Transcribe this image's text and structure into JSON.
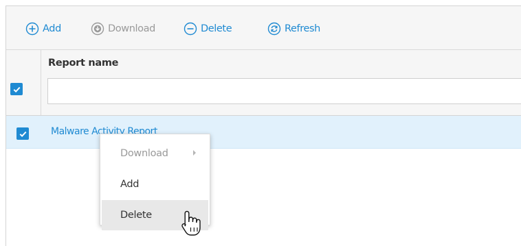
{
  "toolbar": {
    "add_label": "Add",
    "download_label": "Download",
    "delete_label": "Delete",
    "refresh_label": "Refresh"
  },
  "grid": {
    "column_header": "Report name",
    "filter_value": "",
    "rows": [
      {
        "name": "Malware Activity Report",
        "checked": true
      }
    ]
  },
  "context_menu": {
    "items": [
      {
        "label": "Download",
        "enabled": false,
        "has_submenu": true
      },
      {
        "label": "Add",
        "enabled": true
      },
      {
        "label": "Delete",
        "enabled": true,
        "hovered": true
      }
    ]
  },
  "colors": {
    "accent": "#1f8ad2",
    "disabled": "#9a9a9a",
    "selected_row": "#e1f1fc",
    "toolbar_bg": "#f6f6f6"
  },
  "icons": {
    "add": "plus-circle-icon",
    "download": "download-circle-icon",
    "delete": "minus-circle-icon",
    "refresh": "refresh-circle-icon",
    "cursor": "hand-pointer-icon"
  }
}
